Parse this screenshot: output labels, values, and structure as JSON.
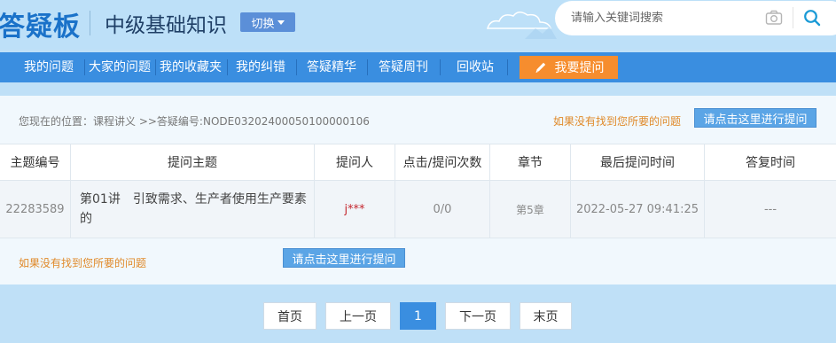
{
  "header": {
    "logo": "答疑板",
    "subtitle": "中级基础知识",
    "switch_label": "切换",
    "search_placeholder": "请输入关键词搜索"
  },
  "nav": {
    "items": [
      {
        "label": "我的问题"
      },
      {
        "label": "大家的问题"
      },
      {
        "label": "我的收藏夹"
      },
      {
        "label": "我的纠错"
      },
      {
        "label": "答疑精华"
      },
      {
        "label": "答疑周刊"
      },
      {
        "label": "回收站"
      }
    ],
    "ask_label": "我要提问"
  },
  "breadcrumb": "您现在的位置：课程讲义 >>答疑编号:NODE03202400050100000106",
  "hint_text": "如果没有找到您所要的问题",
  "ask_here_label": "请点击这里进行提问",
  "table": {
    "headers": [
      "主题编号",
      "提问主题",
      "提问人",
      "点击/提问次数",
      "章节",
      "最后提问时间",
      "答复时间"
    ],
    "rows": [
      {
        "id": "22283589",
        "topic": "第01讲　引致需求、生产者使用生产要素的",
        "asker": "j***",
        "count": "0/0",
        "chapter": "第5章",
        "last_time": "2022-05-27 09:41:25",
        "reply_time": "---"
      }
    ]
  },
  "pagination": {
    "first": "首页",
    "prev": "上一页",
    "current": "1",
    "next": "下一页",
    "last": "末页"
  },
  "colors": {
    "header_bg": "#bde0f8",
    "nav_bg": "#3a8ee0",
    "accent_orange": "#f68d2e",
    "hint_orange": "#e08a2a",
    "asker_red": "#c4262e"
  }
}
